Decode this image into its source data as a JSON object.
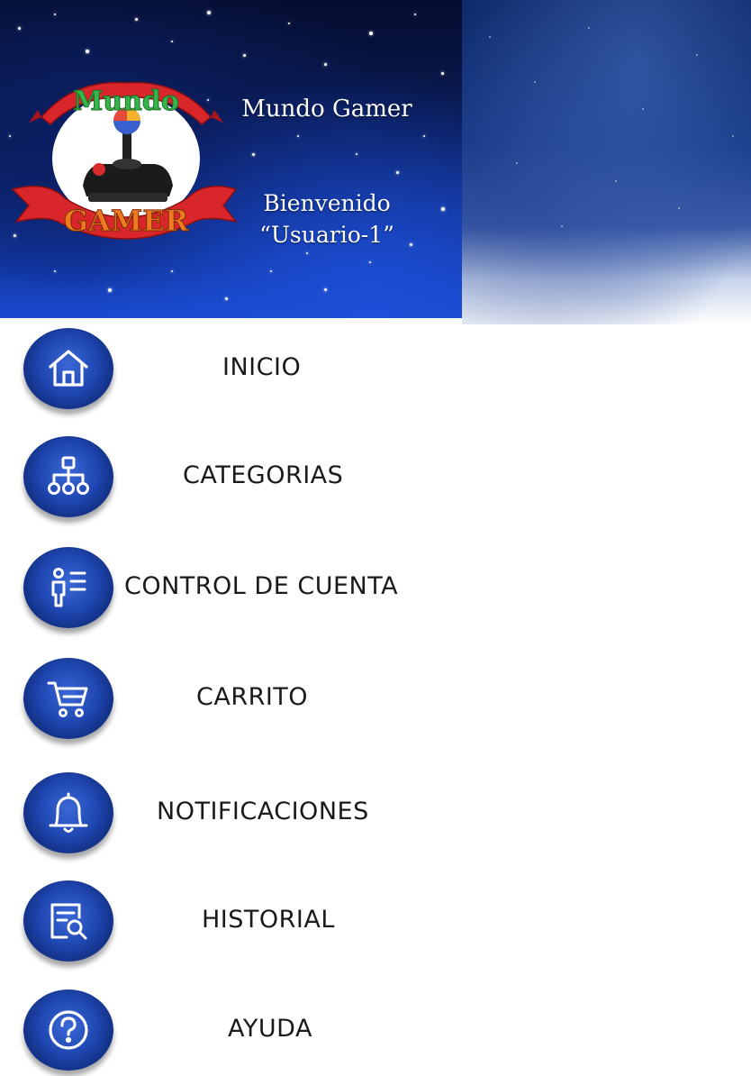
{
  "header": {
    "logo": {
      "top_word": "Mundo",
      "bottom_word": "GAMER"
    },
    "app_title": "Mundo Gamer",
    "welcome_line1": "Bienvenido",
    "welcome_line2": "“Usuario-1”"
  },
  "menu": {
    "items": [
      {
        "label": "INICIO",
        "icon": "home-icon"
      },
      {
        "label": "CATEGORIAS",
        "icon": "sitemap-icon"
      },
      {
        "label": "CONTROL DE CUENTA",
        "icon": "account-control-icon"
      },
      {
        "label": "CARRITO",
        "icon": "cart-icon"
      },
      {
        "label": "NOTIFICACIONES",
        "icon": "bell-icon"
      },
      {
        "label": "HISTORIAL",
        "icon": "history-icon"
      },
      {
        "label": "AYUDA",
        "icon": "help-icon"
      }
    ]
  },
  "colors": {
    "header_dark": "#0a1c58",
    "header_light": "#1a4bd0",
    "icon_circle": "#1f47b2",
    "label_text": "#1a1a1a"
  }
}
